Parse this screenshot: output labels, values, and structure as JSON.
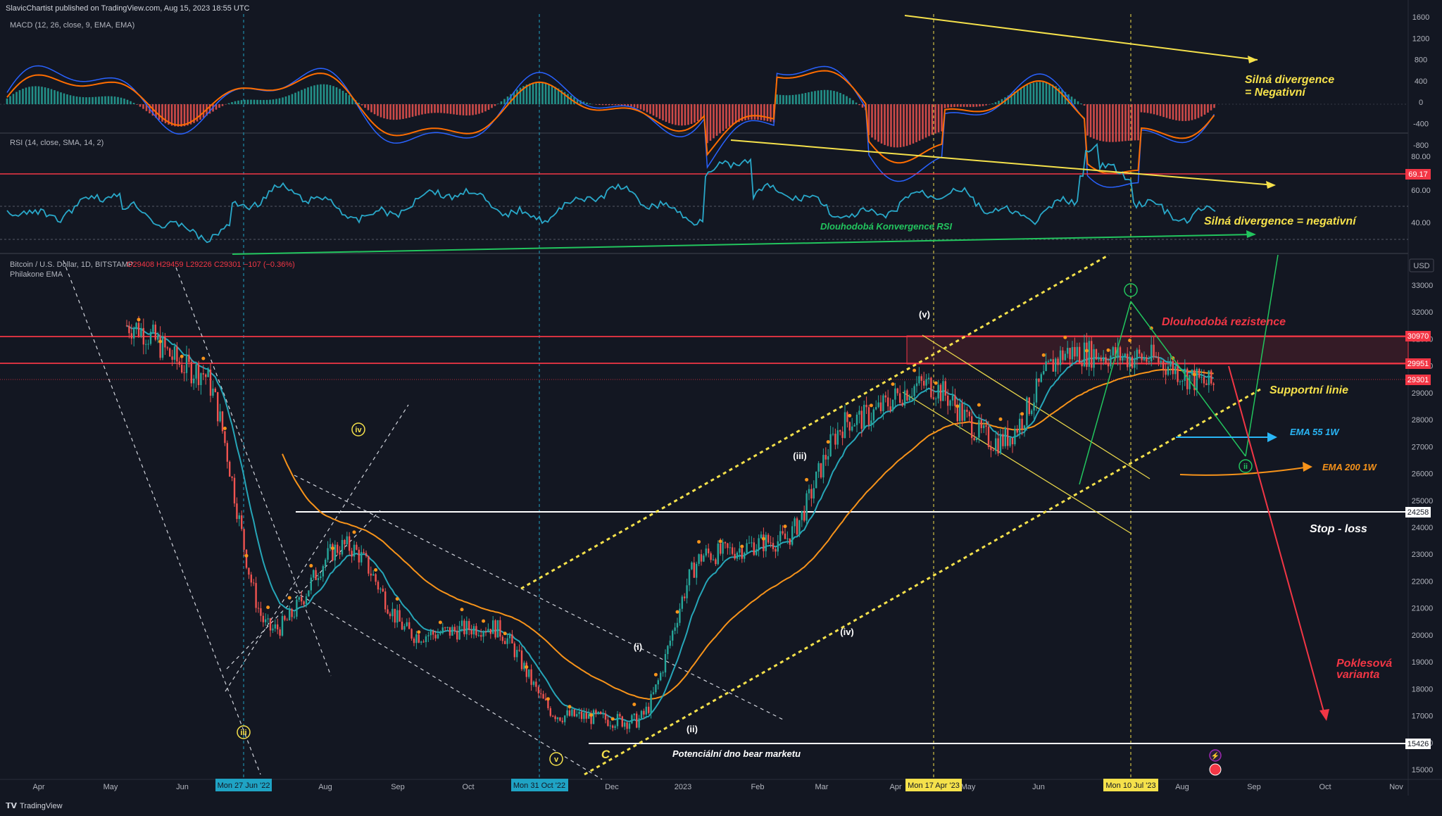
{
  "header": {
    "publisher": "SlavicChartist published on TradingView.com, Aug 15, 2023 18:55 UTC",
    "footer_brand": "TradingView"
  },
  "macd_panel": {
    "title": "MACD (12, 26, close, 9, EMA, EMA)",
    "ticks": [
      "1600",
      "1200",
      "800",
      "400",
      "0",
      "-400",
      "-800"
    ],
    "annotation_1": "Silná divergence",
    "annotation_2": "= Negativní"
  },
  "rsi_panel": {
    "title": "RSI (14, close, SMA, 14, 2)",
    "ticks": [
      "80.00",
      "60.00",
      "40.00"
    ],
    "value_label": "69.17",
    "annotation_convergence": "Dlouhodobá Konvergence RSI",
    "annotation_divergence": "Silná divergence = negativní"
  },
  "price_panel": {
    "title": "Bitcoin / U.S. Dollar, 1D, BITSTAMP",
    "ohlc": {
      "o": "O29408",
      "h": "H29459",
      "l": "L29226",
      "c": "C29301",
      "chg": "−107 (−0.36%)"
    },
    "indicator": "Philakone EMA",
    "currency": "USD",
    "ticks": [
      "33000",
      "32000",
      "31000",
      "30000",
      "29000",
      "28000",
      "27000",
      "26000",
      "25000",
      "24000",
      "23000",
      "22000",
      "21000",
      "20000",
      "19000",
      "18000",
      "17000",
      "16000",
      "15000"
    ],
    "level_labels": {
      "resistance_top": "30970",
      "resistance_bottom": "29951",
      "current": "29301",
      "stop_loss": "24258",
      "bottom": "15426"
    },
    "annotations": {
      "resistance": "Dlouhodobá rezistence",
      "support": "Supportní linie",
      "ema55": "EMA 55 1W",
      "ema200": "EMA 200 1W",
      "stop": "Stop - loss",
      "bear_bottom": "Potenciální dno bear marketu",
      "drop_1": "Poklesová",
      "drop_2": "varianta"
    },
    "wave_labels": {
      "iii_circ": "iii",
      "iv_circ": "iv",
      "v_circ": "v",
      "C": "C",
      "i": "(i)",
      "ii": "(ii)",
      "iii": "(iii)",
      "iv": "(iv)",
      "v": "(v)",
      "i_circ": "i",
      "ii_circ": "ii"
    }
  },
  "time_axis": {
    "labels": [
      "Apr",
      "May",
      "Jun",
      "Aug",
      "Sep",
      "Oct",
      "Dec",
      "2023",
      "Feb",
      "Mar",
      "Apr",
      "May",
      "Jun",
      "Aug",
      "Sep",
      "Oct",
      "Nov"
    ],
    "highlight_cyan_1": "Mon 27 Jun '22",
    "highlight_cyan_2": "Mon 31 Oct '22",
    "highlight_yellow_1": "Mon 17 Apr '23",
    "highlight_yellow_2": "Mon 10 Jul '23"
  },
  "chart_data": {
    "type": "line",
    "title": "Bitcoin / U.S. Dollar, 1D, BITSTAMP",
    "ylabel": "USD",
    "ylim": [
      15000,
      33000
    ],
    "x": [
      "May '22",
      "Jun '22",
      "Jul '22",
      "Aug '22",
      "Sep '22",
      "Oct '22",
      "Nov '22",
      "Dec '22",
      "Jan '23",
      "Feb '23",
      "Mar '23",
      "Apr '23",
      "May '23",
      "Jun '23",
      "Jul '23",
      "Aug '23"
    ],
    "series": [
      {
        "values": [
          31500,
          29800,
          20200,
          23300,
          20000,
          20300,
          17000,
          16800,
          23000,
          23500,
          28000,
          29300,
          27200,
          30500,
          30300,
          29301
        ]
      }
    ],
    "levels": [
      30970,
      29951,
      29301,
      24258,
      15426
    ],
    "colors": {
      "price_up": "#26a69a",
      "price_down": "#ef5350",
      "ema_cyan": "#26a6b8",
      "ema_orange": "#f7931a",
      "annotation_yellow": "#f5e14b",
      "annotation_red": "#f23645",
      "annotation_green": "#22c55e",
      "annotation_cyan": "#29b6f6"
    },
    "grid": false,
    "legend": "top-left"
  }
}
